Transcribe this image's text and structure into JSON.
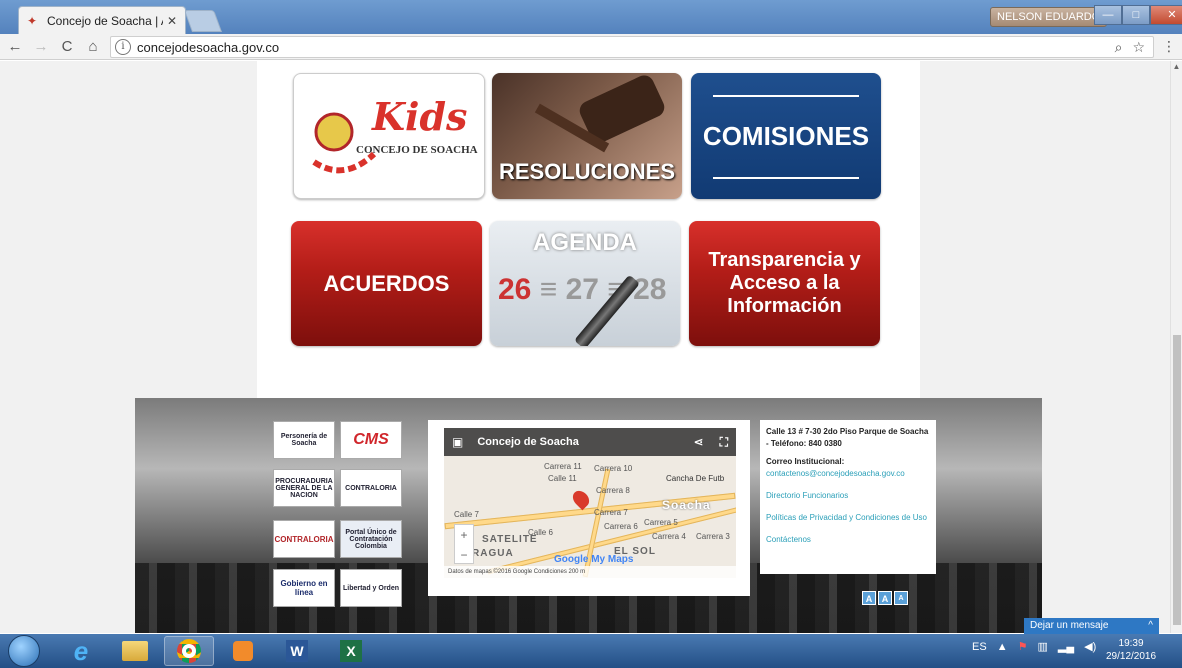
{
  "browser": {
    "tab_title": "Concejo de Soacha | Acu",
    "tab_close": "✕",
    "user_name": "NELSON EDUARDO",
    "url": "concejodesoacha.gov.co",
    "nav": {
      "back": "←",
      "forward": "→",
      "reload": "C",
      "home": "⌂"
    },
    "info_icon": "i",
    "zoom_icon": "⌕",
    "star_icon": "☆",
    "menu_icon": "⋮",
    "window": {
      "minimize": "—",
      "maximize": "□",
      "close": "✕"
    }
  },
  "tiles": {
    "kids": {
      "word": "Kids",
      "concejo": "CONCEJO DE SOACHA"
    },
    "resoluciones": "RESOLUCIONES",
    "comisiones": "COMISIONES",
    "acuerdos": "ACUERDOS",
    "agenda": {
      "title": "AGENDA",
      "d1": "26",
      "d2": "27",
      "d3": "28"
    },
    "transparencia": [
      "Transparencia y",
      "Acceso a la",
      "Información"
    ]
  },
  "footer": {
    "logos": [
      "Personería de Soacha",
      "CMS",
      "PROCURADURIA GENERAL DE LA NACION",
      "CONTRALORIA",
      "CONTRALORIA",
      "Portal Único de Contratación Colombia",
      "Gobierno en línea",
      "Libertad y Orden"
    ],
    "map": {
      "title": "Concejo de Soacha",
      "streets": [
        "Carrera 11",
        "Carrera 10",
        "Carrera 8",
        "Carrera 7",
        "Carrera 6",
        "Carrera 5",
        "Carrera 4",
        "Carrera 3",
        "Calle 7",
        "Calle 6",
        "Calle 11"
      ],
      "places": [
        "Cancha De Futb",
        "Soacha",
        "SATELITE",
        "RAGUA",
        "EL SOL"
      ],
      "google": "Google My Maps",
      "footer_text": "Datos de mapas ©2016 Google   Condiciones   200 m",
      "zoom_in": "+",
      "zoom_out": "−"
    },
    "contact": {
      "address": "Calle 13 # 7-30 2do Piso Parque de Soacha - Teléfono: 840 0380",
      "email_label": "Correo Institucional:",
      "email": "contactenos@concejodesoacha.gov.co",
      "link1": "Directorio Funcionarios",
      "link2": "Políticas de Privacidad y Condiciones de Uso",
      "link3": "Contáctenos"
    },
    "text_size": [
      "A",
      "A",
      "A"
    ]
  },
  "chat": {
    "label": "Dejar un mensaje",
    "icon": "^"
  },
  "taskbar": {
    "tray_lang": "ES",
    "time": "19:39",
    "date": "29/12/2016"
  }
}
